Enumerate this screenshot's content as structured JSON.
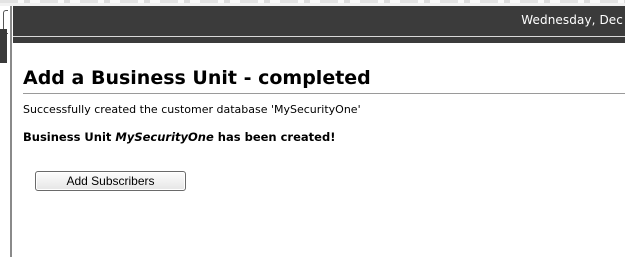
{
  "header": {
    "date_text": "Wednesday, Dec"
  },
  "page": {
    "title": "Add a Business Unit - completed",
    "success_message": "Successfully created the customer database 'MySecurityOne'",
    "created_prefix": "Business Unit ",
    "business_unit_name": "MySecurityOne",
    "created_suffix": " has been created!"
  },
  "actions": {
    "add_subscribers_label": "Add Subscribers"
  },
  "colors": {
    "header_bg": "#3b3b3b",
    "page_bg": "#ffffff"
  }
}
